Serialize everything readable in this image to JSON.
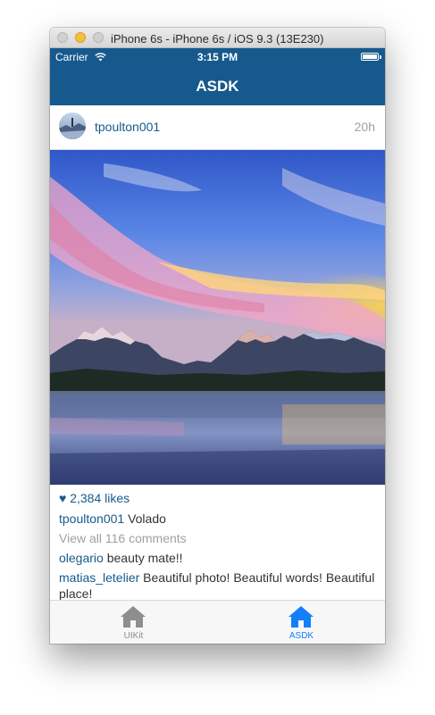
{
  "window": {
    "title": "iPhone 6s - iPhone 6s / iOS 9.3 (13E230)"
  },
  "status_bar": {
    "carrier": "Carrier",
    "time": "3:15 PM",
    "wifi_icon": "wifi-icon",
    "battery_icon": "battery-icon"
  },
  "nav_bar": {
    "title": "ASDK",
    "color": "#165a8d"
  },
  "post": {
    "username": "tpoulton001",
    "time_ago": "20h",
    "photo_icon": "mountain-lake-photo",
    "likes_heart": "♥",
    "likes_text": "2,384 likes",
    "caption_user": "tpoulton001",
    "caption_text": " Volado",
    "view_comments": "View all 116 comments",
    "comments": [
      {
        "user": "olegario",
        "text": " beauty mate!!"
      },
      {
        "user": "matias_letelier",
        "text": " Beautiful photo! Beautiful words! Beautiful place!"
      }
    ]
  },
  "tab_bar": {
    "tabs": [
      {
        "label": "UIKit",
        "icon": "home-icon",
        "selected": false
      },
      {
        "label": "ASDK",
        "icon": "home-icon",
        "selected": true
      }
    ],
    "active_color": "#147efb",
    "inactive_color": "#8e8e8e"
  }
}
